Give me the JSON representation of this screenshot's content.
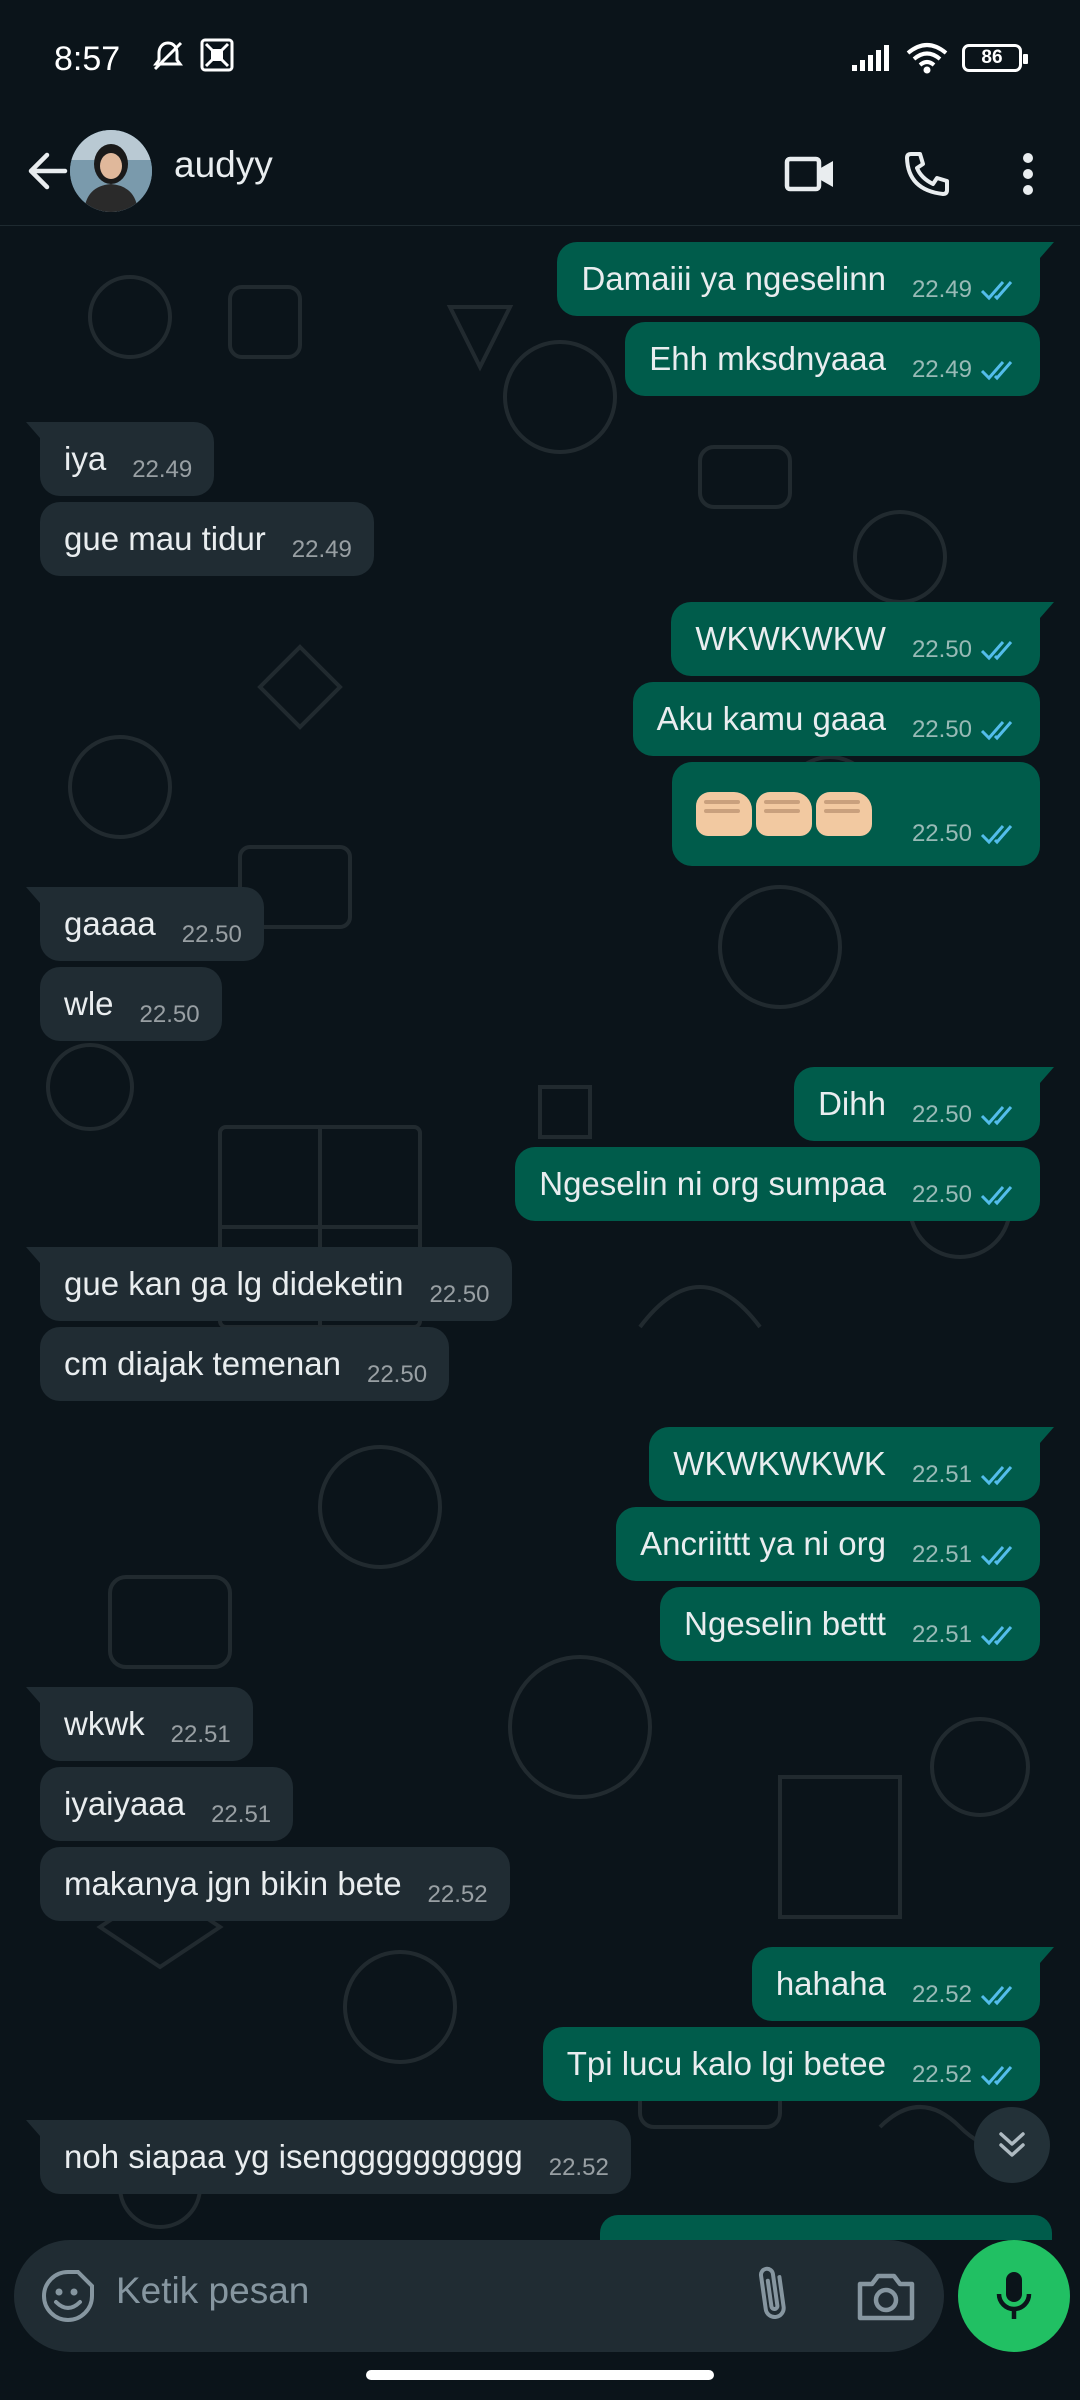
{
  "status_bar": {
    "time": "8:57",
    "battery": "86"
  },
  "header": {
    "contact_name": "audyy"
  },
  "messages": [
    {
      "dir": "out",
      "text": "Damaiii ya ngeselinn",
      "time": "22.49"
    },
    {
      "dir": "out",
      "text": "Ehh mksdnyaaa",
      "time": "22.49"
    },
    {
      "dir": "in",
      "text": "iya",
      "time": "22.49"
    },
    {
      "dir": "in",
      "text": "gue mau tidur",
      "time": "22.49"
    },
    {
      "dir": "out",
      "text": "WKWKWKW",
      "time": "22.50"
    },
    {
      "dir": "out",
      "text": "Aku kamu gaaa",
      "time": "22.50"
    },
    {
      "dir": "out",
      "text": "",
      "emoji": "fist-bump-x3",
      "time": "22.50"
    },
    {
      "dir": "in",
      "text": "gaaaa",
      "time": "22.50"
    },
    {
      "dir": "in",
      "text": "wle",
      "time": "22.50"
    },
    {
      "dir": "out",
      "text": "Dihh",
      "time": "22.50"
    },
    {
      "dir": "out",
      "text": "Ngeselin ni org sumpaa",
      "time": "22.50"
    },
    {
      "dir": "in",
      "text": "gue kan ga lg dideketin",
      "time": "22.50"
    },
    {
      "dir": "in",
      "text": "cm diajak temenan",
      "time": "22.50"
    },
    {
      "dir": "out",
      "text": "WKWKWKWK",
      "time": "22.51"
    },
    {
      "dir": "out",
      "text": "Ancriittt ya ni org",
      "time": "22.51"
    },
    {
      "dir": "out",
      "text": "Ngeselin bettt",
      "time": "22.51"
    },
    {
      "dir": "in",
      "text": "wkwk",
      "time": "22.51"
    },
    {
      "dir": "in",
      "text": "iyaiyaaa",
      "time": "22.51"
    },
    {
      "dir": "in",
      "text": "makanya jgn bikin bete",
      "time": "22.52"
    },
    {
      "dir": "out",
      "text": "hahaha",
      "time": "22.52"
    },
    {
      "dir": "out",
      "text": "Tpi lucu kalo lgi betee",
      "time": "22.52"
    },
    {
      "dir": "in",
      "text": "noh siapaa yg isengggggggggg",
      "time": "22.52"
    }
  ],
  "composer": {
    "placeholder": "Ketik pesan"
  },
  "colors": {
    "background": "#0b141a",
    "incoming_bubble": "#202c33",
    "outgoing_bubble": "#005c4b",
    "read_ticks": "#53bdeb",
    "mic_button": "#21c063"
  },
  "icons": {
    "status": [
      "mute-icon",
      "notification-icon",
      "signal-icon",
      "wifi-icon",
      "battery-icon"
    ],
    "header": [
      "back-arrow-icon",
      "video-call-icon",
      "voice-call-icon",
      "more-options-icon"
    ],
    "composer": [
      "emoji-icon",
      "attach-icon",
      "camera-icon",
      "mic-icon"
    ]
  }
}
